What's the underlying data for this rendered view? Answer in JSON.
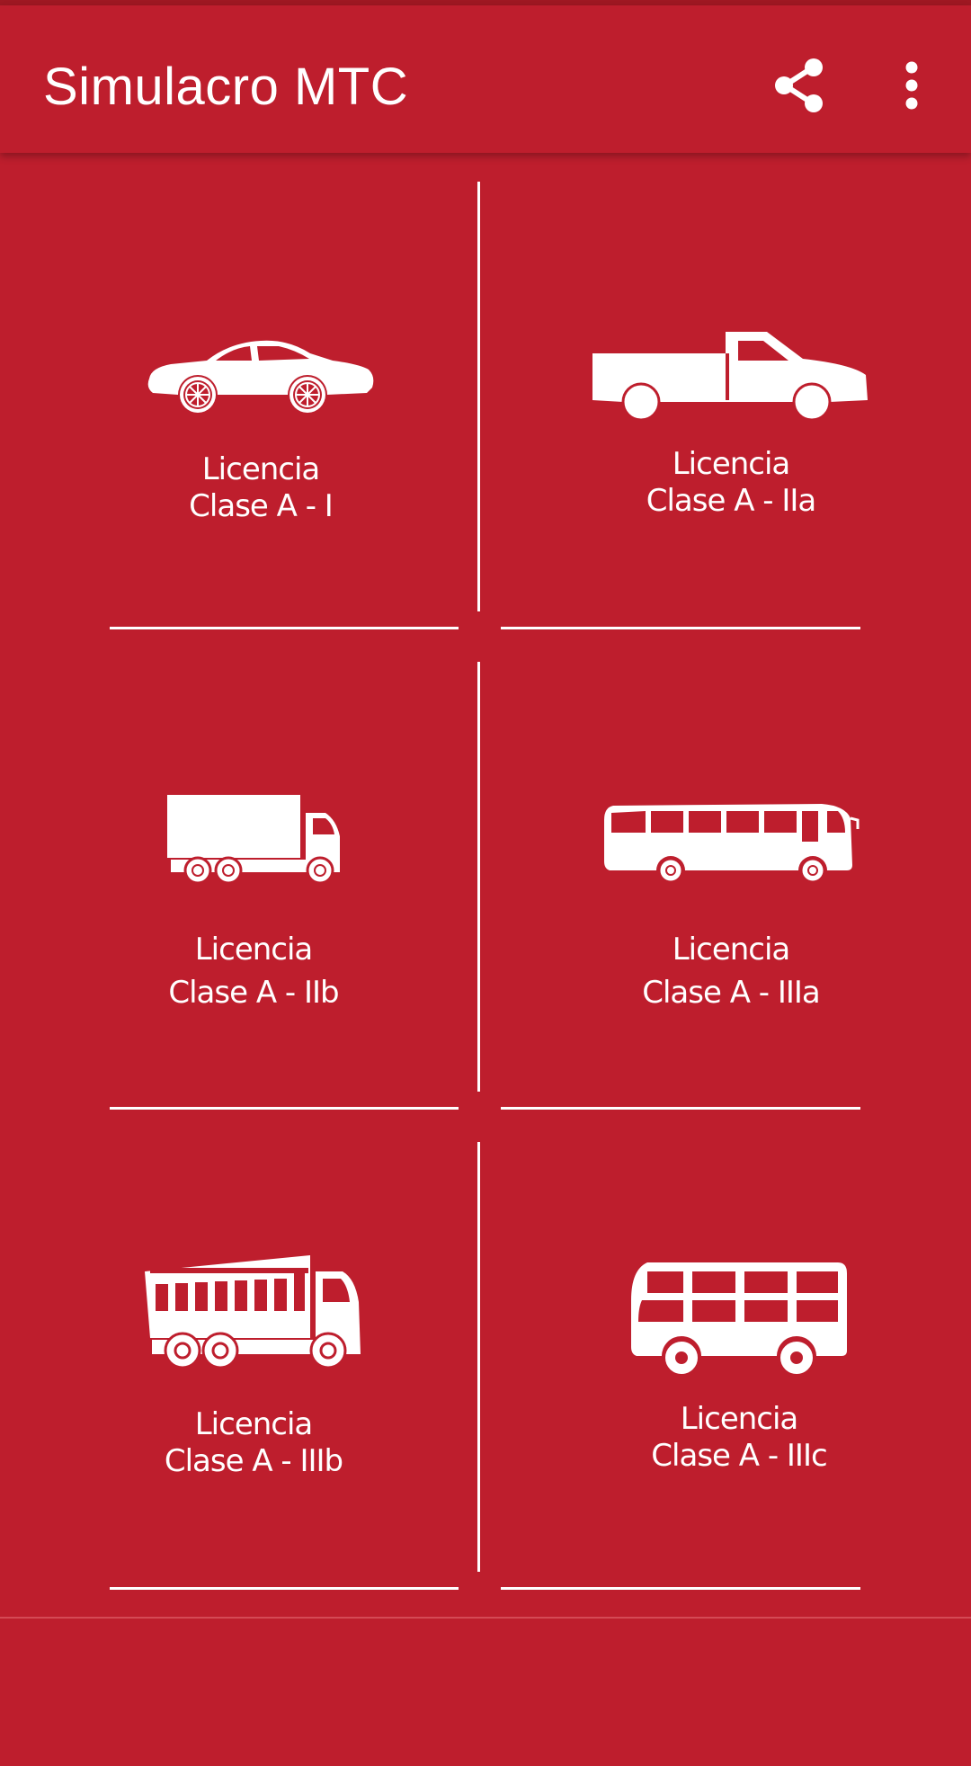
{
  "app": {
    "title": "Simulacro MTC",
    "accent_color": "#be1e2d"
  },
  "toolbar": {
    "share_icon": "share-icon",
    "more_icon": "more-vert-icon"
  },
  "licenses": [
    {
      "icon": "car-icon",
      "line1": "Licencia",
      "line2": "Clase A - I"
    },
    {
      "icon": "pickup-truck-icon",
      "line1": "Licencia",
      "line2": "Clase A - IIa"
    },
    {
      "icon": "box-truck-icon",
      "line1": "Licencia",
      "line2": "Clase A - IIb"
    },
    {
      "icon": "coach-bus-icon",
      "line1": "Licencia",
      "line2": "Clase A - IIIa"
    },
    {
      "icon": "dump-truck-icon",
      "line1": "Licencia",
      "line2": "Clase A - IIIb"
    },
    {
      "icon": "city-bus-icon",
      "line1": "Licencia",
      "line2": "Clase A - IIIc"
    }
  ]
}
